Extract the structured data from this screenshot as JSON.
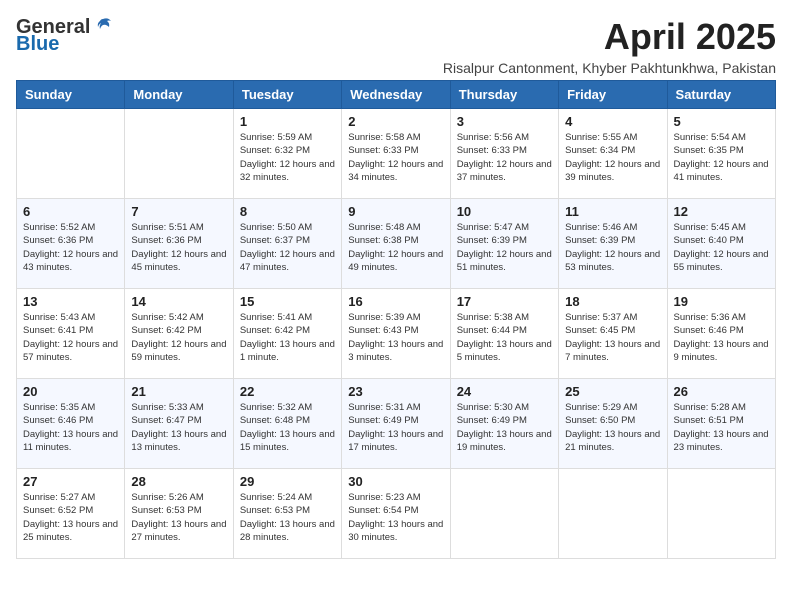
{
  "logo": {
    "general": "General",
    "blue": "Blue"
  },
  "title": "April 2025",
  "subtitle": "Risalpur Cantonment, Khyber Pakhtunkhwa, Pakistan",
  "days_of_week": [
    "Sunday",
    "Monday",
    "Tuesday",
    "Wednesday",
    "Thursday",
    "Friday",
    "Saturday"
  ],
  "weeks": [
    [
      {
        "day": null
      },
      {
        "day": null
      },
      {
        "day": "1",
        "sunrise": "5:59 AM",
        "sunset": "6:32 PM",
        "daylight": "12 hours and 32 minutes."
      },
      {
        "day": "2",
        "sunrise": "5:58 AM",
        "sunset": "6:33 PM",
        "daylight": "12 hours and 34 minutes."
      },
      {
        "day": "3",
        "sunrise": "5:56 AM",
        "sunset": "6:33 PM",
        "daylight": "12 hours and 37 minutes."
      },
      {
        "day": "4",
        "sunrise": "5:55 AM",
        "sunset": "6:34 PM",
        "daylight": "12 hours and 39 minutes."
      },
      {
        "day": "5",
        "sunrise": "5:54 AM",
        "sunset": "6:35 PM",
        "daylight": "12 hours and 41 minutes."
      }
    ],
    [
      {
        "day": "6",
        "sunrise": "5:52 AM",
        "sunset": "6:36 PM",
        "daylight": "12 hours and 43 minutes."
      },
      {
        "day": "7",
        "sunrise": "5:51 AM",
        "sunset": "6:36 PM",
        "daylight": "12 hours and 45 minutes."
      },
      {
        "day": "8",
        "sunrise": "5:50 AM",
        "sunset": "6:37 PM",
        "daylight": "12 hours and 47 minutes."
      },
      {
        "day": "9",
        "sunrise": "5:48 AM",
        "sunset": "6:38 PM",
        "daylight": "12 hours and 49 minutes."
      },
      {
        "day": "10",
        "sunrise": "5:47 AM",
        "sunset": "6:39 PM",
        "daylight": "12 hours and 51 minutes."
      },
      {
        "day": "11",
        "sunrise": "5:46 AM",
        "sunset": "6:39 PM",
        "daylight": "12 hours and 53 minutes."
      },
      {
        "day": "12",
        "sunrise": "5:45 AM",
        "sunset": "6:40 PM",
        "daylight": "12 hours and 55 minutes."
      }
    ],
    [
      {
        "day": "13",
        "sunrise": "5:43 AM",
        "sunset": "6:41 PM",
        "daylight": "12 hours and 57 minutes."
      },
      {
        "day": "14",
        "sunrise": "5:42 AM",
        "sunset": "6:42 PM",
        "daylight": "12 hours and 59 minutes."
      },
      {
        "day": "15",
        "sunrise": "5:41 AM",
        "sunset": "6:42 PM",
        "daylight": "13 hours and 1 minute."
      },
      {
        "day": "16",
        "sunrise": "5:39 AM",
        "sunset": "6:43 PM",
        "daylight": "13 hours and 3 minutes."
      },
      {
        "day": "17",
        "sunrise": "5:38 AM",
        "sunset": "6:44 PM",
        "daylight": "13 hours and 5 minutes."
      },
      {
        "day": "18",
        "sunrise": "5:37 AM",
        "sunset": "6:45 PM",
        "daylight": "13 hours and 7 minutes."
      },
      {
        "day": "19",
        "sunrise": "5:36 AM",
        "sunset": "6:46 PM",
        "daylight": "13 hours and 9 minutes."
      }
    ],
    [
      {
        "day": "20",
        "sunrise": "5:35 AM",
        "sunset": "6:46 PM",
        "daylight": "13 hours and 11 minutes."
      },
      {
        "day": "21",
        "sunrise": "5:33 AM",
        "sunset": "6:47 PM",
        "daylight": "13 hours and 13 minutes."
      },
      {
        "day": "22",
        "sunrise": "5:32 AM",
        "sunset": "6:48 PM",
        "daylight": "13 hours and 15 minutes."
      },
      {
        "day": "23",
        "sunrise": "5:31 AM",
        "sunset": "6:49 PM",
        "daylight": "13 hours and 17 minutes."
      },
      {
        "day": "24",
        "sunrise": "5:30 AM",
        "sunset": "6:49 PM",
        "daylight": "13 hours and 19 minutes."
      },
      {
        "day": "25",
        "sunrise": "5:29 AM",
        "sunset": "6:50 PM",
        "daylight": "13 hours and 21 minutes."
      },
      {
        "day": "26",
        "sunrise": "5:28 AM",
        "sunset": "6:51 PM",
        "daylight": "13 hours and 23 minutes."
      }
    ],
    [
      {
        "day": "27",
        "sunrise": "5:27 AM",
        "sunset": "6:52 PM",
        "daylight": "13 hours and 25 minutes."
      },
      {
        "day": "28",
        "sunrise": "5:26 AM",
        "sunset": "6:53 PM",
        "daylight": "13 hours and 27 minutes."
      },
      {
        "day": "29",
        "sunrise": "5:24 AM",
        "sunset": "6:53 PM",
        "daylight": "13 hours and 28 minutes."
      },
      {
        "day": "30",
        "sunrise": "5:23 AM",
        "sunset": "6:54 PM",
        "daylight": "13 hours and 30 minutes."
      },
      {
        "day": null
      },
      {
        "day": null
      },
      {
        "day": null
      }
    ]
  ],
  "labels": {
    "sunrise_prefix": "Sunrise: ",
    "sunset_prefix": "Sunset: ",
    "daylight_prefix": "Daylight: "
  }
}
